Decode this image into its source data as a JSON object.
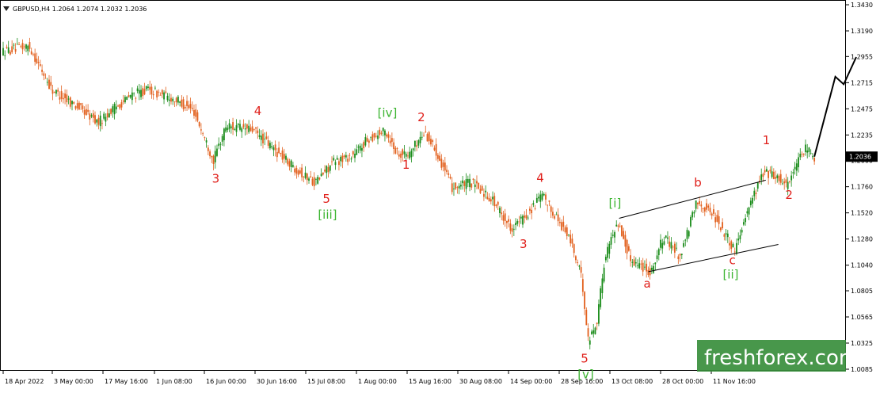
{
  "header": {
    "label": "GBPUSD,H4  1.2064 1.2074 1.2032 1.2036"
  },
  "current_price": "1.2036",
  "watermark": "freshforex.com",
  "colors": {
    "bull": "#1a8c1a",
    "bear": "#e2601d",
    "red_label": "#e0201b",
    "green_label": "#3cb531",
    "projection": "#000000",
    "tag_bg": "#000000"
  },
  "chart_data": {
    "type": "candlestick",
    "symbol": "GBPUSD",
    "timeframe": "H4",
    "ylim": [
      1.0085,
      1.343
    ],
    "y_ticks": [
      "1.3430",
      "1.3190",
      "1.2955",
      "1.2715",
      "1.2475",
      "1.2235",
      "1.2000",
      "1.1760",
      "1.1520",
      "1.1280",
      "1.1040",
      "1.0805",
      "1.0565",
      "1.0325",
      "1.0085"
    ],
    "x_ticks": [
      "18 Apr 2022",
      "3 May 00:00",
      "17 May 16:00",
      "1 Jun 08:00",
      "16 Jun 00:00",
      "30 Jun 16:00",
      "15 Jul 08:00",
      "1 Aug 00:00",
      "15 Aug 16:00",
      "30 Aug 08:00",
      "14 Sep 00:00",
      "28 Sep 16:00",
      "13 Oct 08:00",
      "28 Oct 00:00",
      "11 Nov 16:00"
    ],
    "price_path": [
      [
        0,
        1.3
      ],
      [
        0.033,
        1.305
      ],
      [
        0.06,
        1.265
      ],
      [
        0.09,
        1.25
      ],
      [
        0.115,
        1.235
      ],
      [
        0.13,
        1.245
      ],
      [
        0.155,
        1.26
      ],
      [
        0.175,
        1.265
      ],
      [
        0.21,
        1.255
      ],
      [
        0.23,
        1.245
      ],
      [
        0.253,
        1.2
      ],
      [
        0.268,
        1.232
      ],
      [
        0.3,
        1.228
      ],
      [
        0.33,
        1.207
      ],
      [
        0.36,
        1.187
      ],
      [
        0.375,
        1.18
      ],
      [
        0.395,
        1.198
      ],
      [
        0.42,
        1.205
      ],
      [
        0.438,
        1.22
      ],
      [
        0.458,
        1.227
      ],
      [
        0.472,
        1.208
      ],
      [
        0.485,
        1.205
      ],
      [
        0.505,
        1.226
      ],
      [
        0.52,
        1.207
      ],
      [
        0.538,
        1.175
      ],
      [
        0.56,
        1.18
      ],
      [
        0.585,
        1.165
      ],
      [
        0.608,
        1.138
      ],
      [
        0.625,
        1.148
      ],
      [
        0.645,
        1.168
      ],
      [
        0.665,
        1.145
      ],
      [
        0.68,
        1.125
      ],
      [
        0.693,
        1.09
      ],
      [
        0.7,
        1.035
      ],
      [
        0.71,
        1.05
      ],
      [
        0.72,
        1.11
      ],
      [
        0.735,
        1.145
      ],
      [
        0.75,
        1.11
      ],
      [
        0.775,
        1.098
      ],
      [
        0.79,
        1.13
      ],
      [
        0.81,
        1.112
      ],
      [
        0.83,
        1.163
      ],
      [
        0.85,
        1.15
      ],
      [
        0.875,
        1.118
      ],
      [
        0.89,
        1.155
      ],
      [
        0.91,
        1.19
      ],
      [
        0.925,
        1.185
      ],
      [
        0.937,
        1.178
      ],
      [
        0.96,
        1.212
      ],
      [
        0.968,
        1.2036
      ]
    ],
    "projection": [
      [
        0.968,
        1.2036
      ],
      [
        0.993,
        1.277
      ],
      [
        1.003,
        1.27
      ],
      [
        1.018,
        1.295
      ]
    ],
    "channel_upper": [
      [
        0.735,
        1.147
      ],
      [
        0.91,
        1.182
      ]
    ],
    "channel_lower": [
      [
        0.77,
        1.098
      ],
      [
        0.925,
        1.123
      ]
    ],
    "wave_labels": [
      {
        "text": "3",
        "color": "red",
        "x": 0.253,
        "y": 1.2
      },
      {
        "text": "4",
        "color": "red",
        "x": 0.305,
        "y": 1.229
      },
      {
        "text": "5",
        "color": "red",
        "x": 0.385,
        "y": 1.18
      },
      {
        "text": "[iii]",
        "color": "green",
        "x": 0.385,
        "y": 1.18
      },
      {
        "text": "[iv]",
        "color": "green",
        "x": 0.458,
        "y": 1.227
      },
      {
        "text": "1",
        "color": "red",
        "x": 0.48,
        "y": 1.207
      },
      {
        "text": "2",
        "color": "red",
        "x": 0.502,
        "y": 1.226
      },
      {
        "text": "3",
        "color": "red",
        "x": 0.62,
        "y": 1.14
      },
      {
        "text": "4",
        "color": "red",
        "x": 0.642,
        "y": 1.169
      },
      {
        "text": "5",
        "color": "red",
        "x": 0.693,
        "y": 1.035
      },
      {
        "text": "[v]",
        "color": "green",
        "x": 0.693,
        "y": 1.035
      },
      {
        "text": "[i]",
        "color": "green",
        "x": 0.732,
        "y": 1.147
      },
      {
        "text": "a",
        "color": "red",
        "x": 0.768,
        "y": 1.098
      },
      {
        "text": "b",
        "color": "red",
        "x": 0.832,
        "y": 1.163
      },
      {
        "text": "c",
        "color": "red",
        "x": 0.87,
        "y": 1.118
      },
      {
        "text": "[ii]",
        "color": "green",
        "x": 0.87,
        "y": 1.118
      },
      {
        "text": "1",
        "color": "red",
        "x": 0.91,
        "y": 1.205
      },
      {
        "text": "2",
        "color": "red",
        "x": 0.937,
        "y": 1.178
      }
    ]
  }
}
